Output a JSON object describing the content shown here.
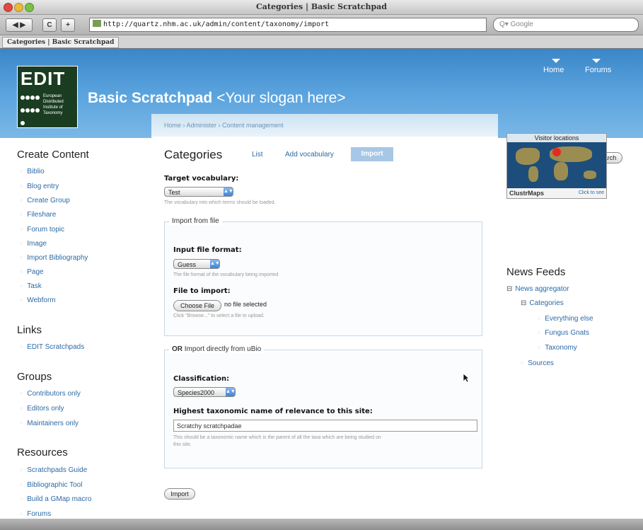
{
  "window": {
    "title": "Categories | Basic Scratchpad"
  },
  "browser": {
    "back_label": "◀ ▶",
    "reload_label": "C",
    "add_label": "+",
    "url": "http://quartz.nhm.ac.uk/admin/content/taxonomy/import",
    "search_placeholder": "Q▾ Google",
    "tab_label": "Categories | Basic Scratchpad"
  },
  "header": {
    "logo_text": "EDIT",
    "logo_subtext": "European Distributed Institute of Taxonomy",
    "site_name": "Basic Scratchpad",
    "slogan": " <Your slogan here>",
    "nav": [
      "Home",
      "Forums"
    ]
  },
  "breadcrumb": "Home › Administer › Content management",
  "content": {
    "title": "Categories",
    "tabs": [
      "List",
      "Add vocabulary",
      "Import"
    ],
    "target_vocab": {
      "label": "Target vocabulary:",
      "value": "Test",
      "description": "The vocabulary into which terms should be loaded."
    },
    "import_from_file": {
      "legend": "Import from file",
      "format_label": "Input file format:",
      "format_value": "Guess",
      "format_description": "The file format of the vocabulary being imported",
      "file_label": "File to import:",
      "choose_file": "Choose File",
      "file_status": "no file selected",
      "file_description": "Click \"Browse...\" to select a file to upload."
    },
    "import_ubio": {
      "legend_bold": "OR",
      "legend_rest": " Import directly from uBio",
      "classification_label": "Classification:",
      "classification_value": "Species2000",
      "taxon_label": "Highest taxonomic name of relevance to this site:",
      "taxon_value": "Scratchy scratchpadae",
      "taxon_description_1": "This should be a taxonomic name which is the parent of all the taxa which are being studied on",
      "taxon_description_2": "this site."
    },
    "import_button": "Import"
  },
  "left_sidebar": {
    "create_title": "Create Content",
    "create_items": [
      "Biblio",
      "Blog entry",
      "Create Group",
      "Fileshare",
      "Forum topic",
      "Image",
      "Import Bibliography",
      "Page",
      "Task",
      "Webform"
    ],
    "links_title": "Links",
    "links_items": [
      "EDIT Scratchpads"
    ],
    "groups_title": "Groups",
    "groups_items": [
      "Contributors only",
      "Editors only",
      "Maintainers only"
    ],
    "resources_title": "Resources",
    "resources_items": [
      "Scratchpads Guide",
      "Bibliographic Tool",
      "Build a GMap macro",
      "Forums"
    ]
  },
  "right_sidebar": {
    "search_button": "Search",
    "map_title": "Visitor locations",
    "map_logo": "ClustrMaps",
    "map_link": "Click to see",
    "news_title": "News Feeds",
    "news_aggregator": "News aggregator",
    "categories": "Categories",
    "category_items": [
      "Everything else",
      "Fungus Gnats",
      "Taxonomy"
    ],
    "sources": "Sources"
  },
  "colors": {
    "header_blue": "#3b86c8",
    "link_blue": "#2d6aa6",
    "logo_green": "#1a3d22"
  }
}
